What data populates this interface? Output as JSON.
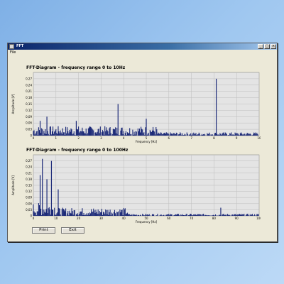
{
  "window": {
    "title": "FFT"
  },
  "menu": {
    "file": "File"
  },
  "buttons": {
    "print": "Print",
    "exit": "Exit"
  },
  "colors": {
    "series": "#1c2a78",
    "plot_bg": "#e4e4e4",
    "grid": "#bdbdbd"
  },
  "chart_data": [
    {
      "type": "bar",
      "title": "FFT-Diagram - frequency range 0 to 10Hz",
      "xlabel": "Frequency [Hz]",
      "ylabel": "Amplitude [V]",
      "xlim": [
        0,
        10
      ],
      "ylim": [
        0,
        0.3
      ],
      "xticks": [
        "0",
        "1",
        "2",
        "3",
        "4",
        "5",
        "6",
        "7",
        "8",
        "9",
        "10"
      ],
      "yticks": [
        "0",
        "0,03",
        "0,06",
        "0,09",
        "0,12",
        "0,15",
        "0,18",
        "0,21",
        "0,24",
        "0,27"
      ],
      "grid": true,
      "peaks": [
        {
          "x": 0.3,
          "y": 0.07
        },
        {
          "x": 0.6,
          "y": 0.09
        },
        {
          "x": 1.9,
          "y": 0.07
        },
        {
          "x": 3.75,
          "y": 0.15
        },
        {
          "x": 5.0,
          "y": 0.08
        },
        {
          "x": 8.1,
          "y": 0.27
        }
      ],
      "noise_amplitude": 0.045
    },
    {
      "type": "bar",
      "title": "FFT-Diagram - frequency range 0 to 100Hz",
      "xlabel": "Frequency [Hz]",
      "ylabel": "Amplitude [V]",
      "xlim": [
        0,
        100
      ],
      "ylim": [
        0,
        0.3
      ],
      "xticks": [
        "0",
        "10",
        "20",
        "30",
        "40",
        "50",
        "60",
        "70",
        "80",
        "90",
        "100"
      ],
      "yticks": [
        "0",
        "0,03",
        "0,06",
        "0,09",
        "0,12",
        "0,15",
        "0,18",
        "0,21",
        "0,24",
        "0,27"
      ],
      "grid": true,
      "peaks": [
        {
          "x": 4,
          "y": 0.28
        },
        {
          "x": 8,
          "y": 0.27
        },
        {
          "x": 3,
          "y": 0.2
        },
        {
          "x": 6,
          "y": 0.18
        },
        {
          "x": 11,
          "y": 0.13
        },
        {
          "x": 83,
          "y": 0.04
        }
      ],
      "noise_amplitude": 0.04
    }
  ]
}
